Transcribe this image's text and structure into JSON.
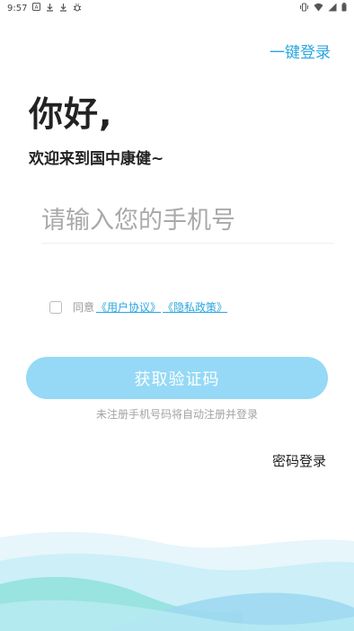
{
  "status_bar": {
    "time": "9:57",
    "left_icons": [
      "a-box-icon",
      "download-icon",
      "download-icon",
      "bug-icon"
    ],
    "right_icons": [
      "vibrate-icon",
      "wifi-icon",
      "signal-icon",
      "battery-icon"
    ]
  },
  "header": {
    "one_key_login": "一键登录"
  },
  "greeting": {
    "title": "你好,",
    "subtitle": "欢迎来到国中康健~"
  },
  "phone": {
    "placeholder": "请输入您的手机号",
    "value": ""
  },
  "agreement": {
    "prefix": "同意",
    "user_agreement": "《用户协议》",
    "privacy_policy": "《隐私政策》",
    "checked": false
  },
  "actions": {
    "get_code": "获取验证码",
    "hint": "未注册手机号码将自动注册并登录",
    "password_login": "密码登录"
  },
  "colors": {
    "accent": "#2aa6e0",
    "button_bg": "#95d9f6",
    "wave_light": "#d6f1f8",
    "wave_mid": "#a8e3ef",
    "wave_teal": "#7fdad9"
  }
}
